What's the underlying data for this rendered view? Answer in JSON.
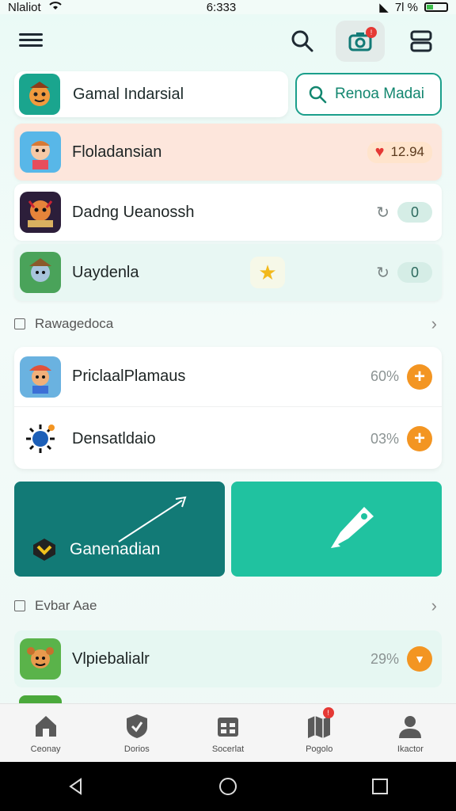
{
  "status_bar": {
    "carrier": "Nlaliot",
    "time": "6:333",
    "battery": "7l %"
  },
  "header": {
    "profile_name": "Gamal Indarsial",
    "search_label": "Renoa Madai",
    "camera_badge": "!"
  },
  "items": [
    {
      "title": "Floladansian",
      "score": "12.94",
      "bg": "#fde6dc"
    },
    {
      "title": "Dadng Ueanossh",
      "count": "0",
      "bg": "#ffffff"
    },
    {
      "title": "Uaydenla",
      "count": "0",
      "bg": "#e8f7f3"
    }
  ],
  "section1": {
    "label": "Rawagedoca"
  },
  "group": [
    {
      "title": "PriclaalPlamaus",
      "percent": "60%"
    },
    {
      "title": "Densatldaio",
      "percent": "03%"
    }
  ],
  "tiles": {
    "left_label": "Ganenadian"
  },
  "section2": {
    "label": "Evbar Aae"
  },
  "bottom_item": {
    "title": "Vlpiebalialr",
    "percent": "29%"
  },
  "tabs": [
    {
      "label": "Ceonay",
      "icon": "home-icon"
    },
    {
      "label": "Dorios",
      "icon": "shield-icon"
    },
    {
      "label": "Socerlat",
      "icon": "calendar-icon"
    },
    {
      "label": "Pogolo",
      "icon": "map-icon",
      "badge": "!"
    },
    {
      "label": "Ikactor",
      "icon": "user-icon"
    }
  ],
  "colors": {
    "accent": "#1b9f8b",
    "tile_dark": "#127a76",
    "tile_light": "#20c2a0",
    "orange": "#f39522"
  }
}
